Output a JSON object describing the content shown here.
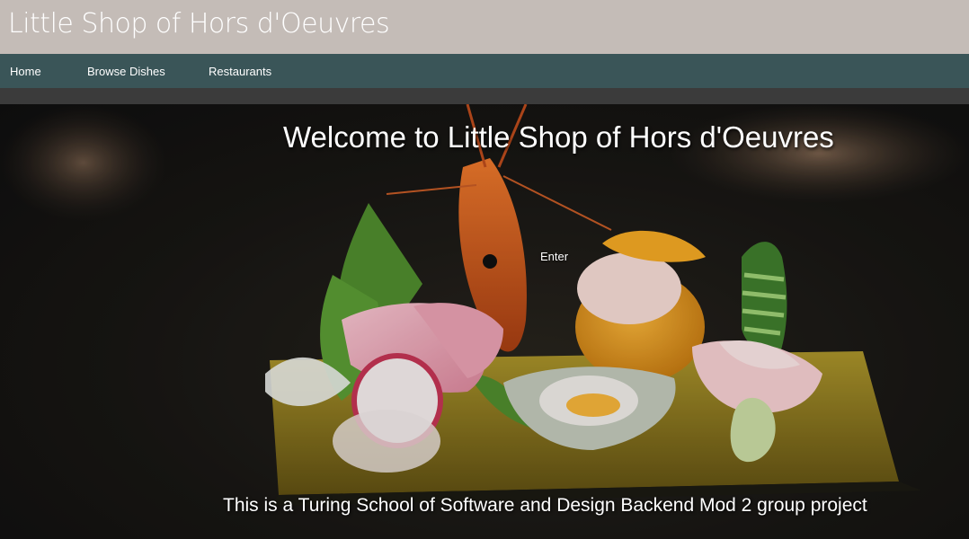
{
  "header": {
    "site_title": "Little Shop of Hors d'Oeuvres"
  },
  "nav": {
    "items": [
      {
        "label": "Home"
      },
      {
        "label": "Browse Dishes"
      },
      {
        "label": "Restaurants"
      }
    ]
  },
  "hero": {
    "heading": "Welcome to Little Shop of Hors d'Oeuvres",
    "enter_label": "Enter",
    "footer_note": "This is a Turing School of Software and Design Backend Mod 2 group project"
  },
  "colors": {
    "header_bg": "#c4bcb7",
    "nav_bg": "#3a5558",
    "text": "#ffffff"
  }
}
